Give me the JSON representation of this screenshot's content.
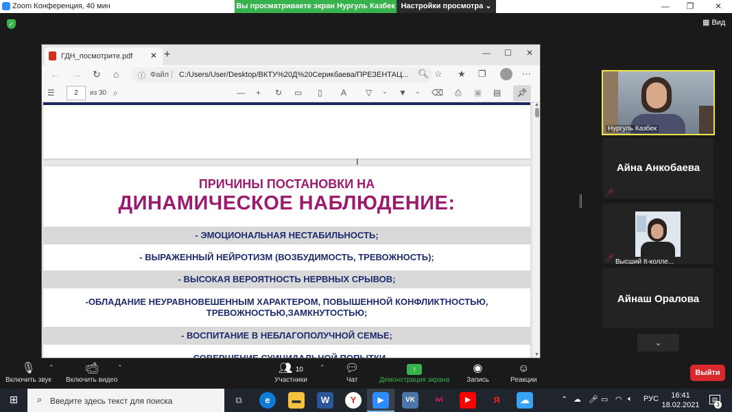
{
  "zoom": {
    "window_title": "Zoom Конференция, 40 мин",
    "share_banner": "Вы просматриваете экран Нургуль Казбек",
    "view_options": "Настройки просмотра ⌄",
    "view_toggle": "Вид",
    "win_controls": {
      "minimize": "—",
      "maximize": "❐",
      "close": "✕"
    }
  },
  "browser": {
    "tab_title": "ГДН_посмотрите.pdf",
    "tab_close": "✕",
    "new_tab": "+",
    "win_controls": {
      "minimize": "—",
      "maximize": "☐",
      "close": "✕"
    },
    "url_prefix": "Файл",
    "url": "C:/Users/User/Desktop/ВКТУ%20Д%20Серикбаева/ПРЕЗЕНТАЦ...",
    "pdf_page": "2",
    "pdf_page_count": "из 30"
  },
  "slide": {
    "title_line1": "ПРИЧИНЫ ПОСТАНОВКИ НА",
    "title_line2": "ДИНАМИЧЕСКОЕ НАБЛЮДЕНИЕ:",
    "items": [
      "- ЭМОЦИОНАЛЬНАЯ НЕСТАБИЛЬНОСТЬ;",
      "- ВЫРАЖЕННЫЙ НЕЙРОТИЗМ (ВОЗБУДИМОСТЬ, ТРЕВОЖНОСТЬ);",
      "- ВЫСОКАЯ ВЕРОЯТНОСТЬ НЕРВНЫХ СРЫВОВ;",
      "-ОБЛАДАНИЕ НЕУРАВНОВЕШЕННЫМ ХАРАКТЕРОМ, ПОВЫШЕННОЙ КОНФЛИКТНОСТЬЮ, ТРЕВОЖНОСТЬЮ,ЗАМКНУТОСТЬЮ;",
      "- ВОСПИТАНИЕ В НЕБЛАГОПОЛУЧНОЙ СЕМЬЕ;",
      "- СОВЕРШЕНИЕ СУИЦИДАЛЬНОЙ ПОПЫТКИ"
    ]
  },
  "participants": {
    "active_speaker": "Нургуль Казбек",
    "tile2": "Айна Анкобаева",
    "tile3": "Высший It-колле...",
    "tile4": "Айнаш Оралова"
  },
  "controls": {
    "audio": "Включить звук",
    "video": "Включить видео",
    "participants": "Участники",
    "participants_count": "10",
    "chat": "Чат",
    "share": "Демонстрация экрана",
    "record": "Запись",
    "reactions": "Реакции",
    "leave": "Выйти"
  },
  "taskbar": {
    "search_placeholder": "Введите здесь текст для поиска",
    "lang": "РУС",
    "time": "16:41",
    "date": "18.02.2021",
    "notifications": "3"
  },
  "colors": {
    "share_banner": "#37b24d",
    "slide_title": "#9b1c6f",
    "slide_text": "#1e2a6e",
    "leave_button": "#d9292f",
    "active_speaker_border": "#f0e64a"
  }
}
